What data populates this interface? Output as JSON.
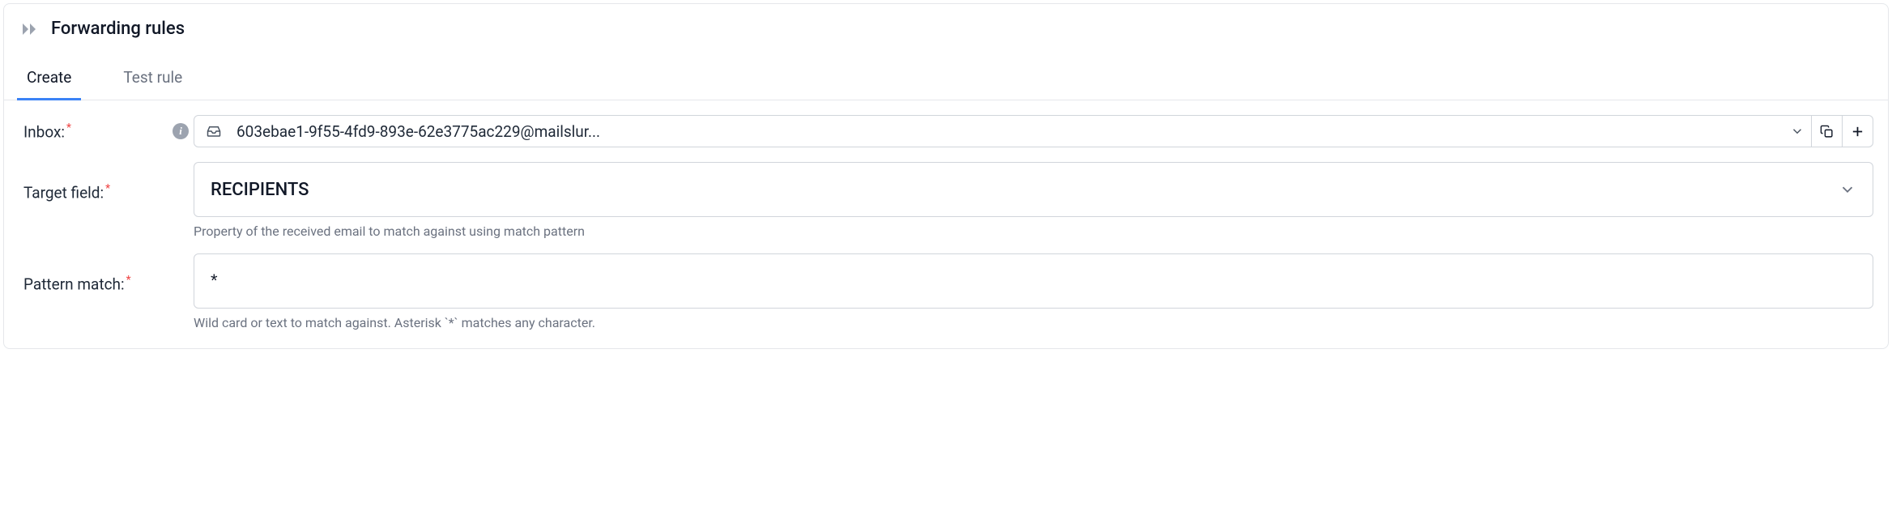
{
  "header": {
    "title": "Forwarding rules"
  },
  "tabs": {
    "create": "Create",
    "test": "Test rule"
  },
  "form": {
    "inbox": {
      "label": "Inbox:",
      "value": "603ebae1-9f55-4fd9-893e-62e3775ac229@mailslur..."
    },
    "target": {
      "label": "Target field:",
      "value": "RECIPIENTS",
      "help": "Property of the received email to match against using match pattern"
    },
    "pattern": {
      "label": "Pattern match:",
      "value": "*",
      "help": "Wild card or text to match against. Asterisk `*` matches any character."
    }
  }
}
